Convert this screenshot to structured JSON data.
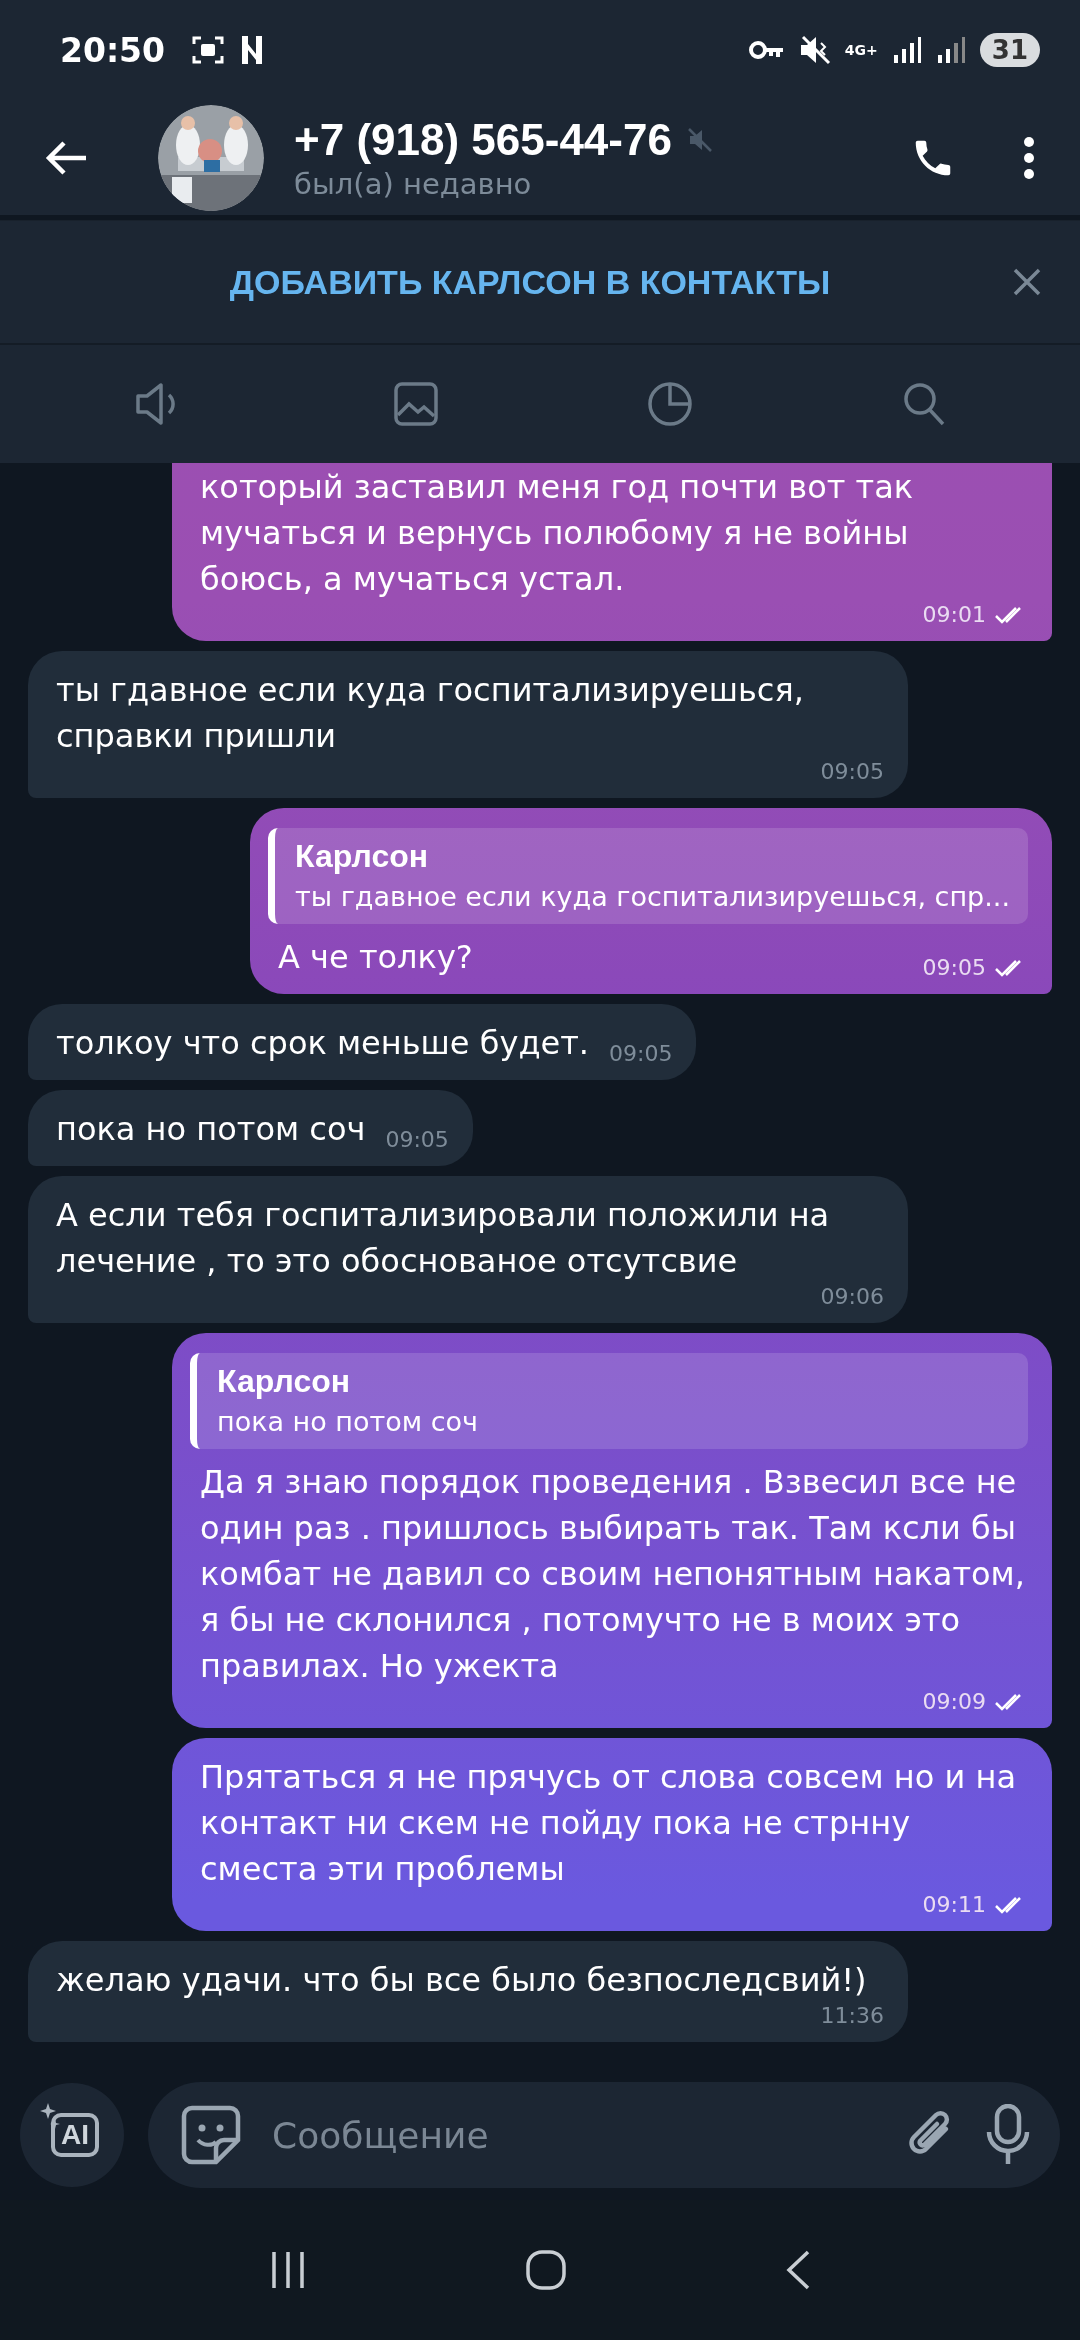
{
  "status_bar": {
    "time": "20:50",
    "network": "4G+",
    "battery": "31"
  },
  "header": {
    "title": "+7 (918) 565-44-76",
    "muted": true,
    "subtitle": "был(а) недавно"
  },
  "banner": {
    "text": "ДОБАВИТЬ КАРЛСОН В КОНТАКТЫ"
  },
  "messages": [
    {
      "kind": "out",
      "text": "который заставил меня год почти вот так мучаться и вернусь полюбому я не войны боюсь, а мучаться устал.",
      "time": "09:01",
      "read": true
    },
    {
      "kind": "in",
      "text": "ты гдавное если куда госпитализируешься, справки пришли",
      "time": "09:05"
    },
    {
      "kind": "out",
      "reply": {
        "author": "Карлсон",
        "text": "ты гдавное если куда госпитализируешься, спр..."
      },
      "text": "А че толку?",
      "time": "09:05",
      "read": true
    },
    {
      "kind": "in",
      "text": "толкоу что срок меньше будет.",
      "time": "09:05"
    },
    {
      "kind": "in",
      "text": "пока но потом соч",
      "time": "09:05"
    },
    {
      "kind": "in",
      "text": "А если тебя госпитализировали положили на лечение , то это обоснованое отсутсвие",
      "time": "09:06"
    },
    {
      "kind": "out",
      "reply": {
        "author": "Карлсон",
        "text": "пока но потом соч"
      },
      "text": "Да я знаю порядок проведения . Взвесил все не один раз . пришлось выбирать так. Там ксли бы комбат не давил со своим непонятным накатом, я бы не склонился , потомучто не в моих это правилах. Но ужекта",
      "time": "09:09",
      "read": true
    },
    {
      "kind": "out",
      "text": "Прятаться я не прячусь от слова совсем но и на контакт ни скем не пойду пока не стрнну сместа эти проблемы",
      "time": "09:11",
      "read": true
    },
    {
      "kind": "in",
      "text": "желаю удачи. что бы все было безпоследсвий!)",
      "time": "11:36"
    }
  ],
  "composer": {
    "ai_label": "AI",
    "placeholder": "Сообщение"
  }
}
